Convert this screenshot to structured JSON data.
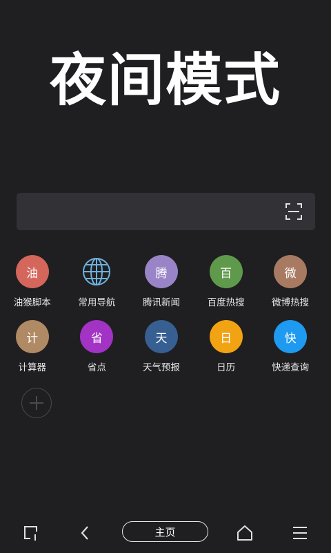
{
  "hero": {
    "title": "夜间模式"
  },
  "search": {
    "placeholder": ""
  },
  "shortcuts": [
    {
      "glyph": "油",
      "label": "油猴脚本",
      "color": "#d4665b",
      "icon": "letter-badge-icon"
    },
    {
      "glyph": "",
      "label": "常用导航",
      "color": "transparent",
      "icon": "globe-icon"
    },
    {
      "glyph": "腾",
      "label": "腾讯新闻",
      "color": "#9a84c8",
      "icon": "letter-badge-icon"
    },
    {
      "glyph": "百",
      "label": "百度热搜",
      "color": "#5f9a4c",
      "icon": "letter-badge-icon"
    },
    {
      "glyph": "微",
      "label": "微博热搜",
      "color": "#a97a62",
      "icon": "letter-badge-icon"
    },
    {
      "glyph": "计",
      "label": "计算器",
      "color": "#b08a64",
      "icon": "letter-badge-icon"
    },
    {
      "glyph": "省",
      "label": "省点",
      "color": "#a233c4",
      "icon": "letter-badge-icon"
    },
    {
      "glyph": "天",
      "label": "天气预报",
      "color": "#375f92",
      "icon": "letter-badge-icon"
    },
    {
      "glyph": "日",
      "label": "日历",
      "color": "#f2a314",
      "icon": "letter-badge-icon"
    },
    {
      "glyph": "快",
      "label": "快递查询",
      "color": "#1e9af0",
      "icon": "letter-badge-icon"
    }
  ],
  "bottom_bar": {
    "home_label": "主页",
    "icons": [
      "tabs-icon",
      "back-icon",
      "home-icon",
      "menu-icon"
    ]
  },
  "colors": {
    "background": "#1f1f21",
    "search_bar": "#323236",
    "globe_stroke": "#6fb1dc"
  }
}
